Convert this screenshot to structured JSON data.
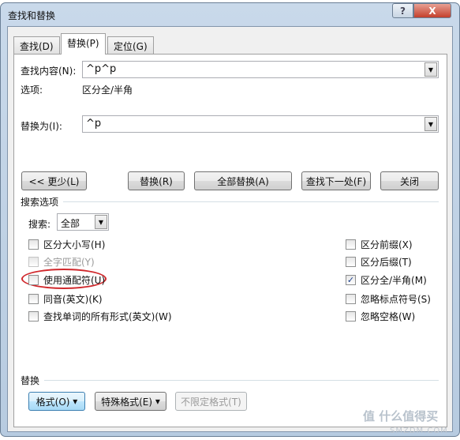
{
  "window": {
    "title": "查找和替换",
    "help": "?",
    "close": "X"
  },
  "tabs": [
    {
      "label": "查找(D)"
    },
    {
      "label": "替换(P)",
      "active": true
    },
    {
      "label": "定位(G)"
    }
  ],
  "find": {
    "label": "查找内容(N):",
    "value": "^p^p",
    "options_label": "选项:",
    "options_value": "区分全/半角"
  },
  "replace": {
    "label": "替换为(I):",
    "value": "^p"
  },
  "buttons": {
    "less": "<< 更少(L)",
    "replace": "替换(R)",
    "replace_all": "全部替换(A)",
    "find_next": "查找下一处(F)",
    "close": "关闭"
  },
  "search_options": {
    "heading": "搜索选项",
    "search_label": "搜索:",
    "search_value": "全部"
  },
  "checkboxes_left": [
    {
      "label": "区分大小写(H)",
      "checked": false,
      "disabled": false
    },
    {
      "label": "全字匹配(Y)",
      "checked": false,
      "disabled": true
    },
    {
      "label": "使用通配符(U)",
      "checked": false,
      "disabled": false,
      "highlighted": true
    },
    {
      "label": "同音(英文)(K)",
      "checked": false,
      "disabled": false
    },
    {
      "label": "查找单词的所有形式(英文)(W)",
      "checked": false,
      "disabled": false
    }
  ],
  "checkboxes_right": [
    {
      "label": "区分前缀(X)",
      "checked": false
    },
    {
      "label": "区分后缀(T)",
      "checked": false
    },
    {
      "label": "区分全/半角(M)",
      "checked": true
    },
    {
      "label": "忽略标点符号(S)",
      "checked": false
    },
    {
      "label": "忽略空格(W)",
      "checked": false
    }
  ],
  "replace_section": {
    "heading": "替换",
    "format": "格式(O)",
    "special": "特殊格式(E)",
    "no_format": "不限定格式(T)"
  },
  "watermark": {
    "text": "什么值得买",
    "sub": "SMZDM.COM"
  },
  "colors": {
    "highlight_ellipse": "#d0282c",
    "close_button": "#c4402c"
  }
}
